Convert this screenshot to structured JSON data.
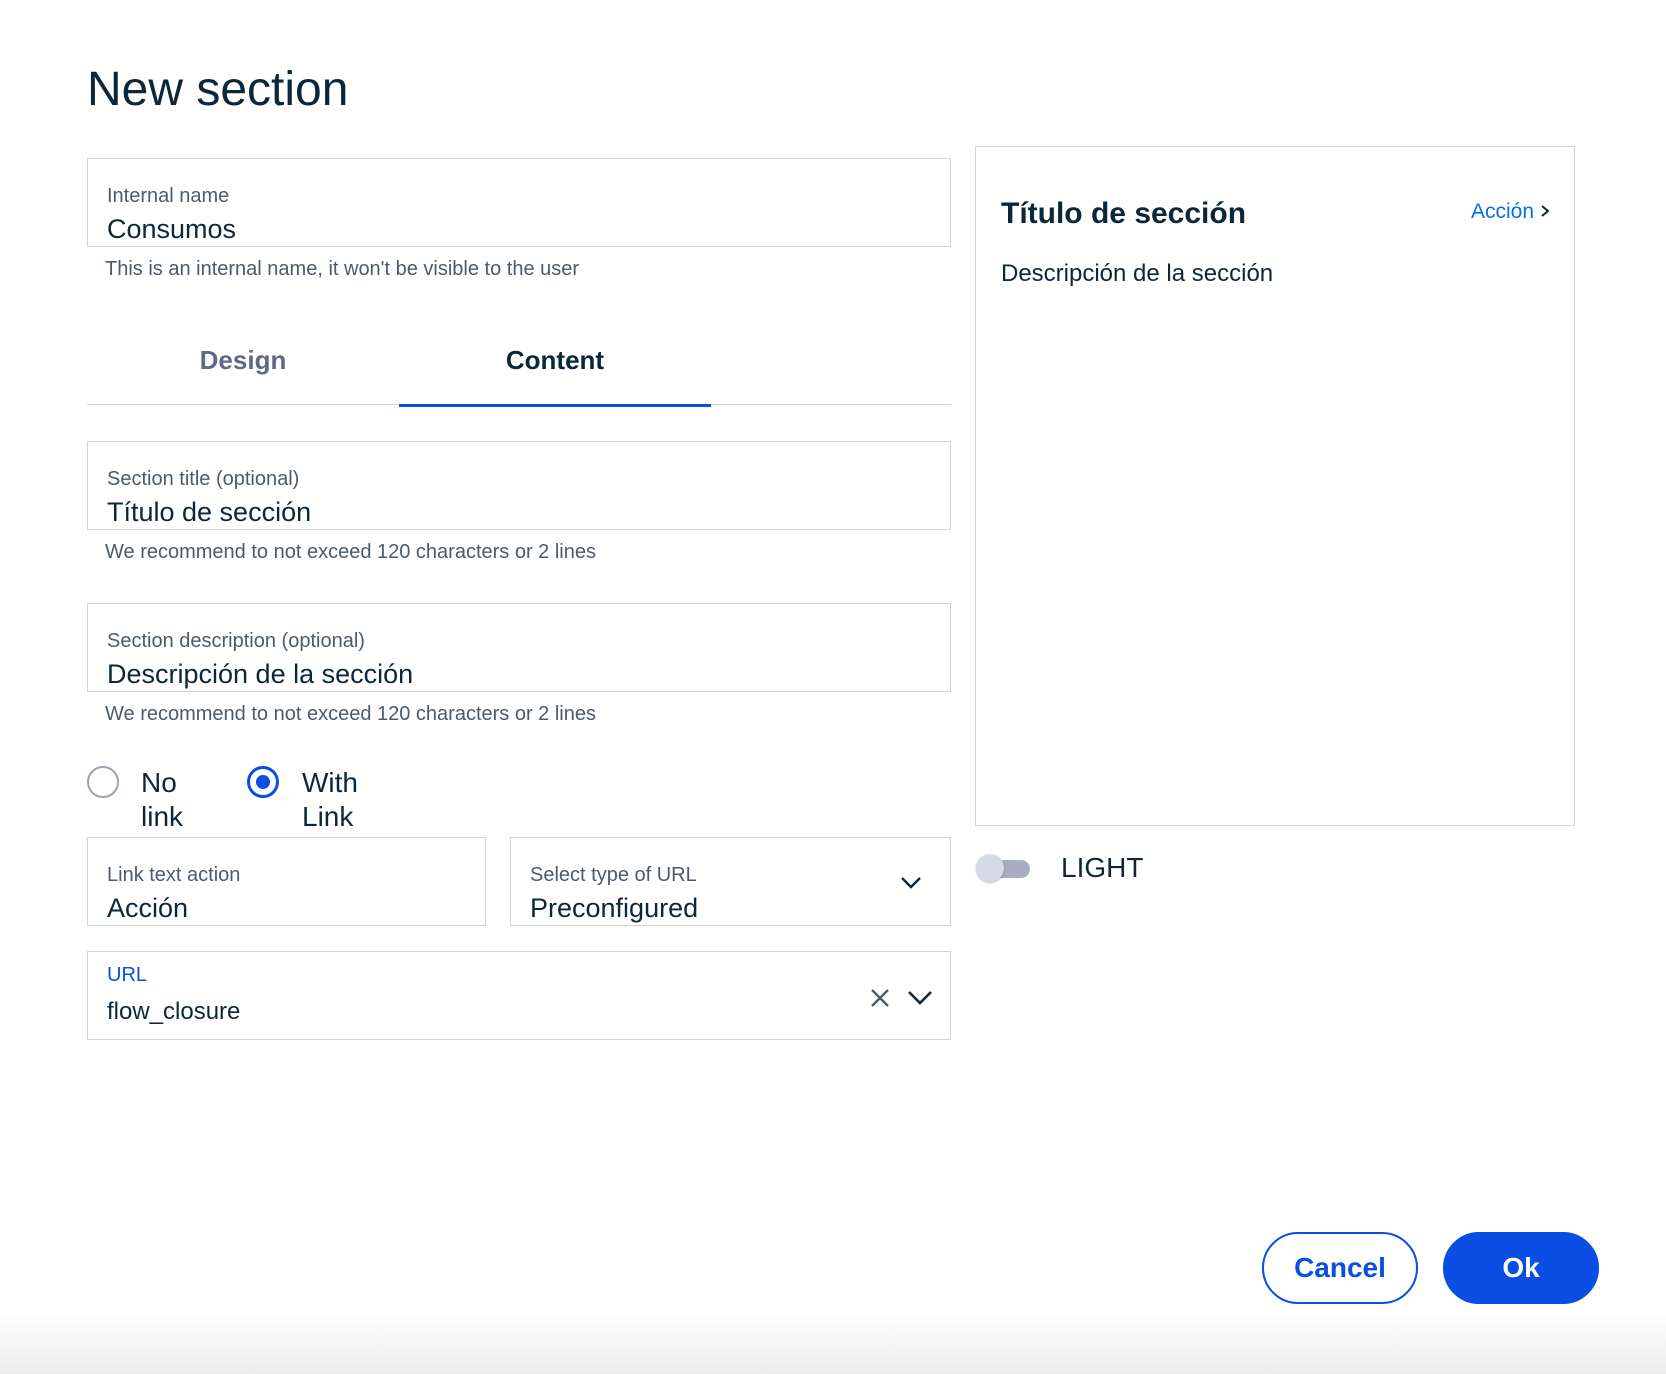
{
  "dialog": {
    "title": "New section"
  },
  "internal_name": {
    "label": "Internal name",
    "value": "Consumos",
    "helper": "This is an internal name, it won't be visible to the user"
  },
  "tabs": [
    {
      "label": "Design",
      "active": false
    },
    {
      "label": "Content",
      "active": true
    }
  ],
  "section_title": {
    "label": "Section title (optional)",
    "value": "Título de sección",
    "helper": "We recommend to not exceed 120 characters or 2 lines"
  },
  "section_description": {
    "label": "Section description (optional)",
    "value": "Descripción de la sección",
    "helper": "We recommend to not exceed 120 characters or 2 lines"
  },
  "link_options": [
    {
      "label": "No link",
      "checked": false
    },
    {
      "label": "With Link",
      "checked": true
    }
  ],
  "link_text": {
    "label": "Link text action",
    "value": "Acción"
  },
  "url_type": {
    "label": "Select type of URL",
    "value": "Preconfigured"
  },
  "url": {
    "label": "URL",
    "value": "flow_closure"
  },
  "preview": {
    "title": "Título de sección",
    "action": "Acción",
    "description": "Descripción de la sección"
  },
  "theme_toggle": {
    "label": "LIGHT",
    "on": false
  },
  "footer": {
    "cancel_label": "Cancel",
    "ok_label": "Ok"
  },
  "colors": {
    "accent": "#0b4ee3",
    "link": "#0b6fe3",
    "text": "#0b2739",
    "muted": "#4d5a6e",
    "border": "#d0d3dd"
  }
}
